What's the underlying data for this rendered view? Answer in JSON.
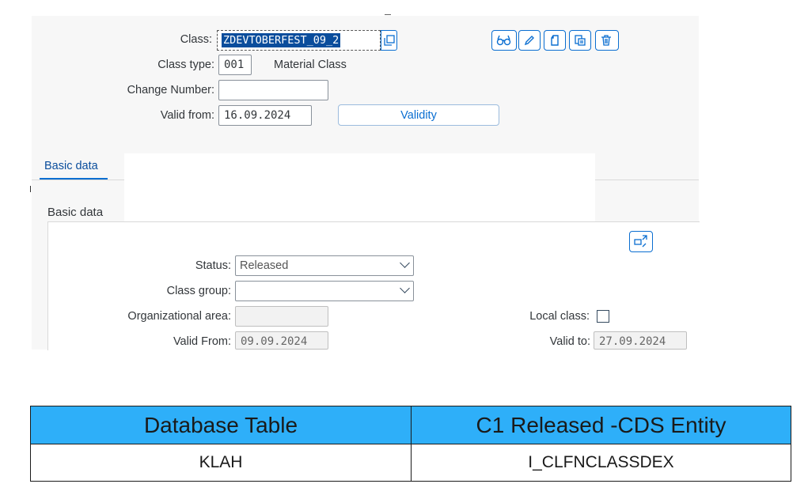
{
  "header": {
    "class_label": "Class:",
    "class_value": "ZDEVTOBERFEST_09_2",
    "class_type_label": "Class type:",
    "class_type_value": "001",
    "class_type_desc": "Material Class",
    "change_number_label": "Change Number:",
    "change_number_value": "",
    "valid_from_label": "Valid from:",
    "valid_from_value": "16.09.2024",
    "validity_button": "Validity",
    "toolbar_icons": [
      "display-icon",
      "edit-icon",
      "create-icon",
      "copy-icon",
      "delete-icon"
    ]
  },
  "tabs": [
    {
      "label": "Basic data",
      "selected": true
    }
  ],
  "basic_data": {
    "section_title": "Basic data",
    "status_label": "Status:",
    "status_value": "Released",
    "class_group_label": "Class group:",
    "class_group_value": "",
    "org_area_label": "Organizational area:",
    "org_area_value": "",
    "local_class_label": "Local class:",
    "local_class_checked": false,
    "valid_from_label": "Valid From:",
    "valid_from_value": "09.09.2024",
    "valid_to_label": "Valid to:",
    "valid_to_value": "27.09.2024"
  },
  "mapping_table": {
    "headers": [
      "Database Table",
      "C1 Released -CDS Entity"
    ],
    "rows": [
      [
        "KLAH",
        "I_CLFNCLASSDEX"
      ]
    ]
  },
  "colors": {
    "accent": "#0a6ed1",
    "selection": "#0a4d9c",
    "table_header": "#2eaff9"
  }
}
